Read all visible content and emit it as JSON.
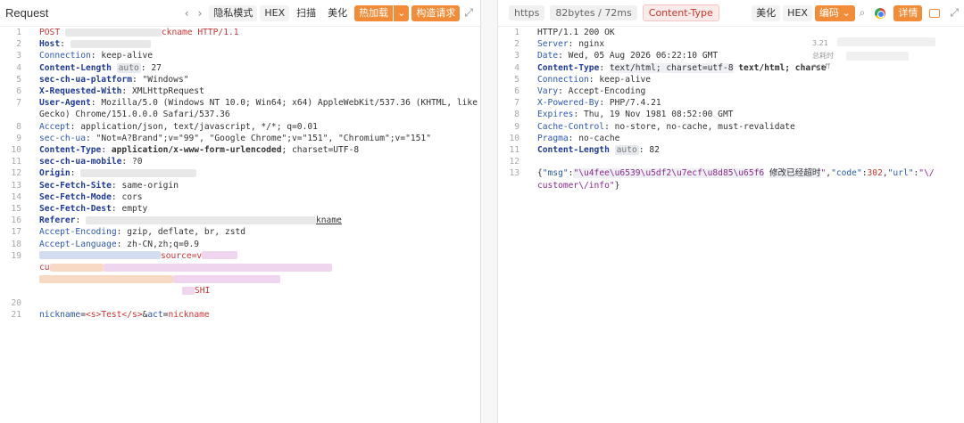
{
  "request": {
    "title": "Request",
    "toolbar": {
      "privacy": "隐私模式",
      "hex": "HEX",
      "scan": "扫描",
      "beautify": "美化",
      "hot_load": "热加载",
      "build_request": "构造请求"
    },
    "lines": {
      "l1_method": "POST ",
      "l1_path": "ckname",
      "l1_proto": " HTTP/1.1",
      "l2_key": "Host",
      "l3_key": "Connection",
      "l3_val": "keep-alive",
      "l4_key": "Content-Length",
      "l4_hint": "auto",
      "l4_val": "27",
      "l5_key": "sec-ch-ua-platform",
      "l5_val": "\"Windows\"",
      "l6_key": "X-Requested-With",
      "l6_val": "XMLHttpRequest",
      "l7_key": "User-Agent",
      "l7_val": "Mozilla/5.0 (Windows NT 10.0; Win64; x64) AppleWebKit/537.36 (KHTML, like",
      "l7_cont": "Gecko) Chrome/151.0.0.0 Safari/537.36",
      "l8_key": "Accept",
      "l8_val": "application/json, text/javascript, */*; q=0.01",
      "l9_key": "sec-ch-ua",
      "l9_val": "\"Not=A?Brand\";v=\"99\", \"Google Chrome\";v=\"151\", \"Chromium\";v=\"151\"",
      "l10_key": "Content-Type",
      "l10_val_bold": "application/x-www-form-urlencoded",
      "l10_val": "; charset=UTF-8",
      "l11_key": "sec-ch-ua-mobile",
      "l11_val": "?0",
      "l12_key": "Origin",
      "l13_key": "Sec-Fetch-Site",
      "l13_val": "same-origin",
      "l14_key": "Sec-Fetch-Mode",
      "l14_val": "cors",
      "l15_key": "Sec-Fetch-Dest",
      "l15_val": "empty",
      "l16_key": "Referer",
      "l16_tail": "kname",
      "l17_key": "Accept-Encoding",
      "l17_val": "gzip, deflate, br, zstd",
      "l18_key": "Accept-Language",
      "l18_val": "zh-CN,zh;q=0.9",
      "l19_frag": "source=v",
      "l19_frag2": "cu",
      "l19_frag3": "SHI",
      "l21_k1": "nickname",
      "l21_v1": "<s>Test</s>",
      "l21_amp": "&",
      "l21_k2": "act",
      "l21_v2": "nickname"
    }
  },
  "response": {
    "toolbar": {
      "scheme": "https",
      "size_time": "82bytes / 72ms",
      "content_type": "Content-Type",
      "beautify": "美化",
      "hex": "HEX",
      "encoding": "编码",
      "details": "详情"
    },
    "lines": {
      "l1": "HTTP/1.1 200 OK",
      "l2_key": "Server",
      "l2_val": "nginx",
      "l3_key": "Date",
      "l3_val": "Wed, 05 Aug 2026 06:22:10 GMT",
      "l4_key": "Content-Type",
      "l4_val": "text/html; charset=utf-8",
      "l4_extra": " text/html; charse",
      "l5_key": "Connection",
      "l5_val": "keep-alive",
      "l6_key": "Vary",
      "l6_val": "Accept-Encoding",
      "l7_key": "X-Powered-By",
      "l7_val": "PHP/7.4.21",
      "l8_key": "Expires",
      "l8_val": "Thu, 19 Nov 1981 08:52:00 GMT",
      "l9_key": "Cache-Control",
      "l9_val": "no-store, no-cache, must-revalidate",
      "l10_key": "Pragma",
      "l10_val": "no-cache",
      "l11_key": "Content-Length",
      "l11_hint": "auto",
      "l11_val": "82",
      "l13_open": "{",
      "l13_k_msg": "\"msg\"",
      "l13_v_msg": "\"\\u4fee\\u6539\\u5df2\\u7ecf\\u8d85\\u65f6",
      "l13_v_msg_decoded": "修改已经超时",
      "l13_v_msg_close": "\"",
      "l13_k_code": "\"code\"",
      "l13_v_code": "302",
      "l13_k_url": "\"url\"",
      "l13_v_url_a": "\"\\/",
      "l13_v_url_b": "customer\\/info\"",
      "l13_close": "}"
    },
    "overlay": {
      "ghost_1": "3.21",
      "ghost_2": "总耗时",
      "ghost_3": "ncoff"
    }
  },
  "line_numbers": [
    "1",
    "2",
    "3",
    "4",
    "5",
    "6",
    "7",
    "8",
    "9",
    "10",
    "11",
    "12",
    "13",
    "14",
    "15",
    "16",
    "17",
    "18",
    "19",
    "20",
    "21"
  ]
}
